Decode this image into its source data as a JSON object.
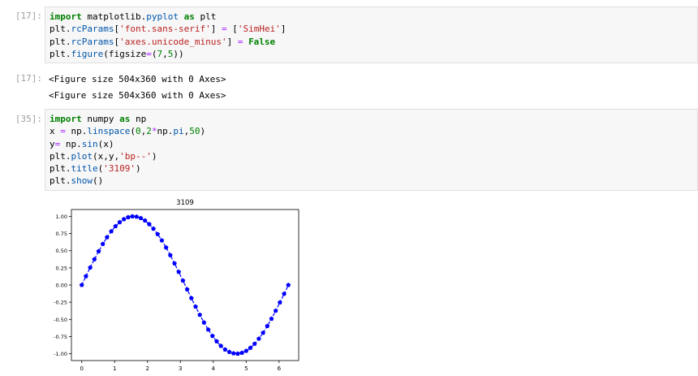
{
  "cells": [
    {
      "prompt": "[17]:",
      "lines": [
        [
          {
            "t": "import",
            "c": "kw"
          },
          {
            "t": " matplotlib.",
            "c": ""
          },
          {
            "t": "pyplot",
            "c": "fn"
          },
          {
            "t": " ",
            "c": ""
          },
          {
            "t": "as",
            "c": "kw"
          },
          {
            "t": " plt",
            "c": ""
          }
        ],
        [
          {
            "t": "plt.",
            "c": ""
          },
          {
            "t": "rcParams",
            "c": "fn"
          },
          {
            "t": "[",
            "c": ""
          },
          {
            "t": "'font.sans-serif'",
            "c": "str"
          },
          {
            "t": "] ",
            "c": ""
          },
          {
            "t": "=",
            "c": "op"
          },
          {
            "t": " [",
            "c": ""
          },
          {
            "t": "'SimHei'",
            "c": "str"
          },
          {
            "t": "]",
            "c": ""
          }
        ],
        [
          {
            "t": "plt.",
            "c": ""
          },
          {
            "t": "rcParams",
            "c": "fn"
          },
          {
            "t": "[",
            "c": ""
          },
          {
            "t": "'axes.unicode_minus'",
            "c": "str"
          },
          {
            "t": "] ",
            "c": ""
          },
          {
            "t": "=",
            "c": "op"
          },
          {
            "t": " ",
            "c": ""
          },
          {
            "t": "False",
            "c": "kw"
          }
        ],
        [
          {
            "t": "plt.",
            "c": ""
          },
          {
            "t": "figure",
            "c": "fn"
          },
          {
            "t": "(figsize",
            "c": ""
          },
          {
            "t": "=",
            "c": "op"
          },
          {
            "t": "(",
            "c": ""
          },
          {
            "t": "7",
            "c": "num"
          },
          {
            "t": ",",
            "c": ""
          },
          {
            "t": "5",
            "c": "num"
          },
          {
            "t": "))",
            "c": ""
          }
        ]
      ]
    },
    {
      "prompt": "[35]:",
      "lines": [
        [
          {
            "t": "import",
            "c": "kw"
          },
          {
            "t": " numpy ",
            "c": ""
          },
          {
            "t": "as",
            "c": "kw"
          },
          {
            "t": " np",
            "c": ""
          }
        ],
        [
          {
            "t": "x ",
            "c": ""
          },
          {
            "t": "=",
            "c": "op"
          },
          {
            "t": " np.",
            "c": ""
          },
          {
            "t": "linspace",
            "c": "fn"
          },
          {
            "t": "(",
            "c": ""
          },
          {
            "t": "0",
            "c": "num"
          },
          {
            "t": ",",
            "c": ""
          },
          {
            "t": "2",
            "c": "num"
          },
          {
            "t": "*",
            "c": "op"
          },
          {
            "t": "np.",
            "c": ""
          },
          {
            "t": "pi",
            "c": "fn"
          },
          {
            "t": ",",
            "c": ""
          },
          {
            "t": "50",
            "c": "num"
          },
          {
            "t": ")",
            "c": ""
          }
        ],
        [
          {
            "t": "y",
            "c": ""
          },
          {
            "t": "=",
            "c": "op"
          },
          {
            "t": " np.",
            "c": ""
          },
          {
            "t": "sin",
            "c": "fn"
          },
          {
            "t": "(x)",
            "c": ""
          }
        ],
        [
          {
            "t": "plt.",
            "c": ""
          },
          {
            "t": "plot",
            "c": "fn"
          },
          {
            "t": "(x,y,",
            "c": ""
          },
          {
            "t": "'bp--'",
            "c": "str"
          },
          {
            "t": ")",
            "c": ""
          }
        ],
        [
          {
            "t": "plt.",
            "c": ""
          },
          {
            "t": "title",
            "c": "fn"
          },
          {
            "t": "(",
            "c": ""
          },
          {
            "t": "'3109'",
            "c": "str"
          },
          {
            "t": ")",
            "c": ""
          }
        ],
        [
          {
            "t": "plt.",
            "c": ""
          },
          {
            "t": "show",
            "c": "fn"
          },
          {
            "t": "()",
            "c": ""
          }
        ]
      ]
    }
  ],
  "output_17": {
    "prompt": "[17]:",
    "result": "<Figure size 504x360 with 0 Axes>",
    "printed": "<Figure size 504x360 with 0 Axes>"
  },
  "colors": {
    "line": "#0000ff",
    "axes": "#000000"
  },
  "chart_data": {
    "type": "line",
    "title": "3109",
    "xlabel": "",
    "ylabel": "",
    "xlim": [
      -0.314,
      6.597
    ],
    "ylim": [
      -1.1,
      1.1
    ],
    "xticks": [
      0,
      1,
      2,
      3,
      4,
      5,
      6
    ],
    "yticks": [
      1.0,
      0.75,
      0.5,
      0.25,
      0.0,
      -0.25,
      -0.5,
      -0.75,
      -1.0
    ],
    "ytick_labels": [
      "1.00",
      "0.75",
      "0.50",
      "0.25",
      "0.00",
      "-0.25",
      "-0.50",
      "-0.75",
      "-1.00"
    ],
    "grid": false,
    "series": [
      {
        "style": "bp--",
        "marker": "pentagon",
        "linestyle": "dashed",
        "x": [
          0.0,
          0.128,
          0.256,
          0.385,
          0.513,
          0.641,
          0.769,
          0.898,
          1.026,
          1.154,
          1.282,
          1.411,
          1.539,
          1.667,
          1.795,
          1.923,
          2.052,
          2.18,
          2.308,
          2.436,
          2.565,
          2.693,
          2.821,
          2.949,
          3.077,
          3.206,
          3.334,
          3.462,
          3.59,
          3.718,
          3.847,
          3.975,
          4.103,
          4.231,
          4.36,
          4.488,
          4.616,
          4.744,
          4.872,
          5.001,
          5.129,
          5.257,
          5.385,
          5.514,
          5.642,
          5.77,
          5.898,
          6.026,
          6.155,
          6.283
        ],
        "y": [
          0.0,
          0.128,
          0.254,
          0.375,
          0.491,
          0.598,
          0.696,
          0.782,
          0.856,
          0.915,
          0.959,
          0.987,
          1.0,
          0.995,
          0.975,
          0.939,
          0.887,
          0.82,
          0.741,
          0.649,
          0.546,
          0.434,
          0.315,
          0.191,
          0.064,
          -0.064,
          -0.191,
          -0.315,
          -0.434,
          -0.546,
          -0.649,
          -0.741,
          -0.82,
          -0.887,
          -0.939,
          -0.975,
          -0.995,
          -1.0,
          -0.987,
          -0.959,
          -0.915,
          -0.856,
          -0.782,
          -0.696,
          -0.598,
          -0.491,
          -0.375,
          -0.254,
          -0.128,
          0.0
        ]
      }
    ]
  }
}
